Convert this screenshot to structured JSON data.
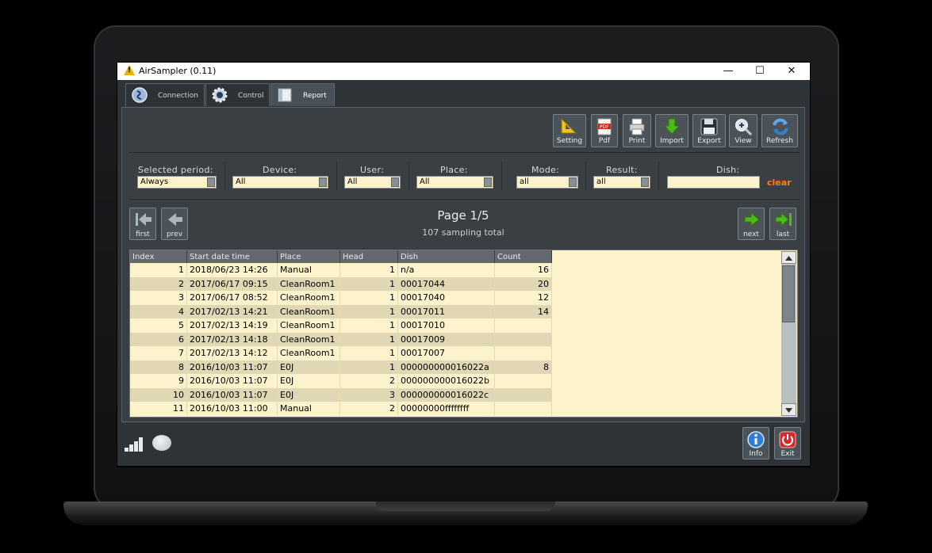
{
  "window": {
    "title": "AirSampler (0.11)",
    "controls": {
      "minimize": "—",
      "maximize": "☐",
      "close": "✕"
    }
  },
  "tabs": [
    {
      "label": "Connection",
      "icon": "usb-connection-icon",
      "active": false
    },
    {
      "label": "Control",
      "icon": "gear-icon",
      "active": false
    },
    {
      "label": "Report",
      "icon": "report-icon",
      "active": true
    }
  ],
  "toolbar": [
    {
      "label": "Setting",
      "icon": "ruler-setting-icon"
    },
    {
      "label": "Pdf",
      "icon": "pdf-icon"
    },
    {
      "label": "Print",
      "icon": "printer-icon"
    },
    {
      "label": "Import",
      "icon": "download-arrow-icon"
    },
    {
      "label": "Export",
      "icon": "floppy-disk-icon"
    },
    {
      "label": "View",
      "icon": "magnifier-icon"
    },
    {
      "label": "Refresh",
      "icon": "refresh-icon"
    }
  ],
  "filters": {
    "period": {
      "label": "Selected period:",
      "value": "Always"
    },
    "device": {
      "label": "Device:",
      "value": "All"
    },
    "user": {
      "label": "User:",
      "value": "All"
    },
    "place": {
      "label": "Place:",
      "value": "All"
    },
    "mode": {
      "label": "Mode:",
      "value": "all"
    },
    "result": {
      "label": "Result:",
      "value": "all"
    },
    "dish": {
      "label": "Dish:",
      "value": "",
      "clear_label": "clear"
    }
  },
  "pager": {
    "title": "Page 1/5",
    "total": "107 sampling total",
    "first": "first",
    "prev": "prev",
    "next": "next",
    "last": "last"
  },
  "table": {
    "headers": [
      "Index",
      "Start date time",
      "Place",
      "Head",
      "Dish",
      "Count"
    ],
    "rows": [
      [
        "1",
        "2018/06/23 14:26",
        "Manual",
        "1",
        "n/a",
        "16"
      ],
      [
        "2",
        "2017/06/17 09:15",
        "CleanRoom1",
        "1",
        "00017044",
        "20"
      ],
      [
        "3",
        "2017/06/17 08:52",
        "CleanRoom1",
        "1",
        "00017040",
        "12"
      ],
      [
        "4",
        "2017/02/13 14:21",
        "CleanRoom1",
        "1",
        "00017011",
        "14"
      ],
      [
        "5",
        "2017/02/13 14:19",
        "CleanRoom1",
        "1",
        "00017010",
        ""
      ],
      [
        "6",
        "2017/02/13 14:18",
        "CleanRoom1",
        "1",
        "00017009",
        ""
      ],
      [
        "7",
        "2017/02/13 14:12",
        "CleanRoom1",
        "1",
        "00017007",
        ""
      ],
      [
        "8",
        "2016/10/03 11:07",
        "E0J",
        "1",
        "000000000016022a",
        "8"
      ],
      [
        "9",
        "2016/10/03 11:07",
        "E0J",
        "2",
        "000000000016022b",
        ""
      ],
      [
        "10",
        "2016/10/03 11:07",
        "E0J",
        "3",
        "000000000016022c",
        ""
      ],
      [
        "11",
        "2016/10/03 11:00",
        "Manual",
        "2",
        "00000000ffffffff",
        ""
      ]
    ]
  },
  "bottom": {
    "info": "Info",
    "exit": "Exit"
  },
  "colors": {
    "table_bg": "#fcf3cc",
    "table_alt": "#e0d7b4",
    "panel_bg": "#3a3f43",
    "accent_clear": "#ff7a1a",
    "arrow_green": "#4cbb17"
  }
}
